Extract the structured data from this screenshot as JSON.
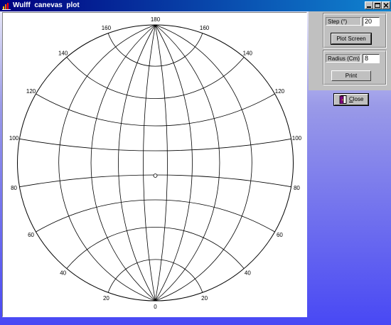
{
  "window": {
    "title": "Wulff  canevas  plot",
    "controls": [
      "minimize",
      "maximize",
      "close"
    ]
  },
  "panel": {
    "step_label": "Step (°)",
    "step_value": "20",
    "plot_button": "Plot Screen",
    "radius_label": "Radius (Cm)",
    "radius_value": "8",
    "print_button": "Print",
    "close_button": "Close",
    "close_hotkey": "C",
    "close_rest": "lose"
  },
  "net": {
    "step_degrees": 20,
    "labels": {
      "top": "180",
      "bottom": "0",
      "upper_left": [
        "160",
        "140",
        "120",
        "100"
      ],
      "upper_right": [
        "160",
        "140",
        "120",
        "100"
      ],
      "lower_left": [
        "80",
        "60",
        "40",
        "20"
      ],
      "lower_right": [
        "80",
        "60",
        "40",
        "20"
      ]
    }
  },
  "colors": {
    "title_bar_start": "#000080",
    "title_bar_end": "#1084d0",
    "background_top": "#e6e6f8",
    "background_bottom": "#4848f4",
    "panel": "#c0c0c0"
  }
}
